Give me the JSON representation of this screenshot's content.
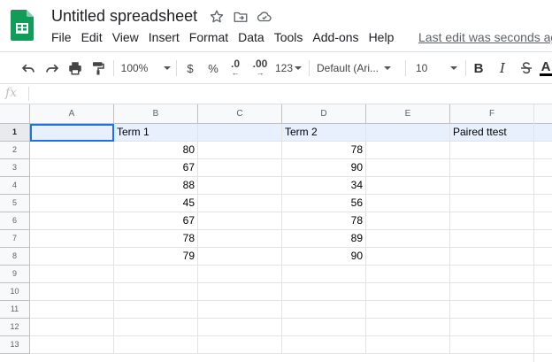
{
  "app": {
    "title": "Untitled spreadsheet",
    "last_edit": "Last edit was seconds ago",
    "accent": "#1a73e8",
    "icons": [
      "sheets-logo-icon",
      "star-icon",
      "move-folder-icon",
      "cloud-saved-icon"
    ]
  },
  "menu": [
    "File",
    "Edit",
    "View",
    "Insert",
    "Format",
    "Data",
    "Tools",
    "Add-ons",
    "Help"
  ],
  "toolbar": {
    "zoom": "100%",
    "currency": "$",
    "percent": "%",
    "decrease_decimal": ".0",
    "increase_decimal": ".00",
    "more_formats": "123",
    "font": "Default (Ari...",
    "font_size": "10",
    "bold": "B",
    "italic": "I",
    "text_color": "A"
  },
  "formula_bar": {
    "fx": "fx",
    "value": ""
  },
  "sheet": {
    "columns": [
      "A",
      "B",
      "C",
      "D",
      "E",
      "F"
    ],
    "row_numbers": [
      "1",
      "2",
      "3",
      "4",
      "5",
      "6",
      "7",
      "8",
      "9",
      "10",
      "11",
      "12",
      "13"
    ],
    "selected_cell": "A1",
    "rows": [
      [
        "",
        "Term 1",
        "",
        "Term 2",
        "",
        "Paired ttest"
      ],
      [
        "",
        "80",
        "",
        "78",
        "",
        ""
      ],
      [
        "",
        "67",
        "",
        "90",
        "",
        ""
      ],
      [
        "",
        "88",
        "",
        "34",
        "",
        ""
      ],
      [
        "",
        "45",
        "",
        "56",
        "",
        ""
      ],
      [
        "",
        "67",
        "",
        "78",
        "",
        ""
      ],
      [
        "",
        "78",
        "",
        "89",
        "",
        ""
      ],
      [
        "",
        "79",
        "",
        "90",
        "",
        ""
      ],
      [
        "",
        "",
        "",
        "",
        "",
        ""
      ],
      [
        "",
        "",
        "",
        "",
        "",
        ""
      ],
      [
        "",
        "",
        "",
        "",
        "",
        ""
      ],
      [
        "",
        "",
        "",
        "",
        "",
        ""
      ],
      [
        "",
        "",
        "",
        "",
        "",
        ""
      ]
    ]
  }
}
